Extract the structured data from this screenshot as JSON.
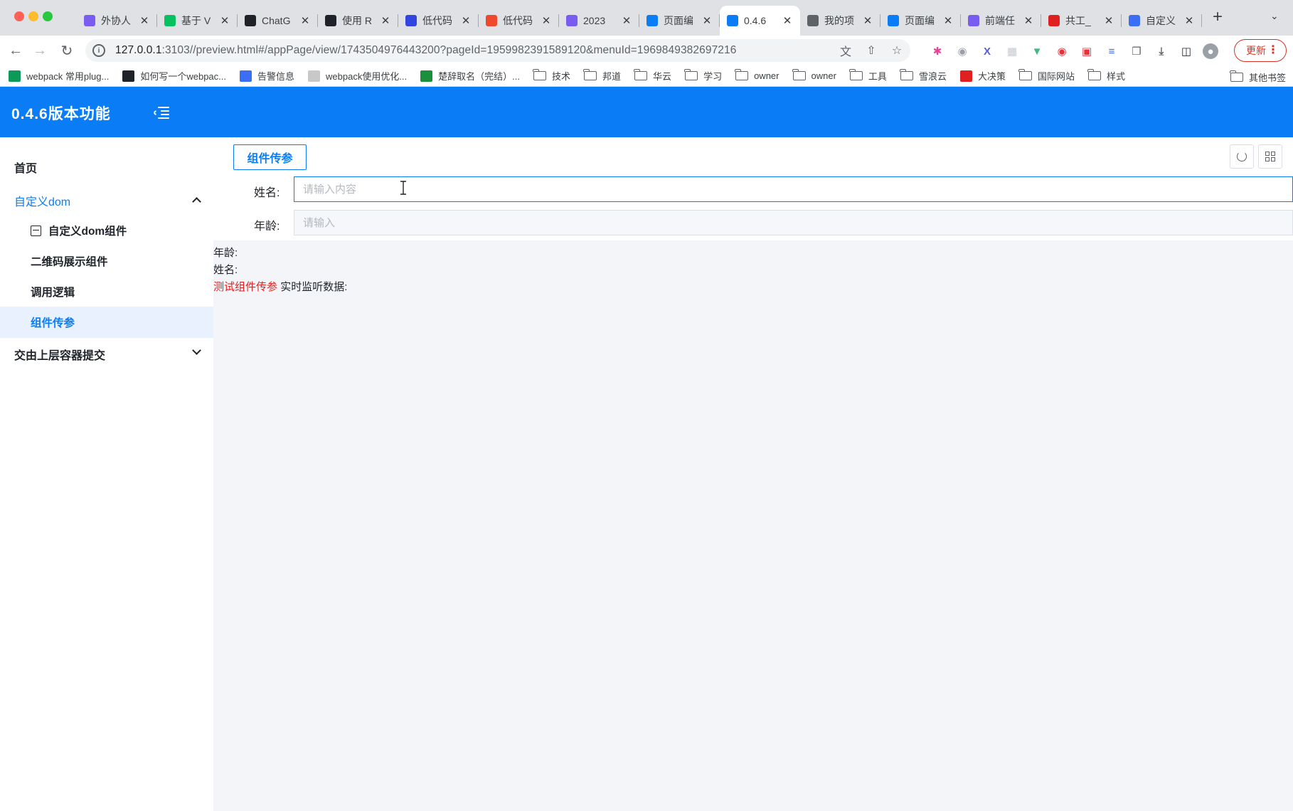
{
  "browser": {
    "tabs": [
      {
        "title": "外协人",
        "favicon_color": "#7b5cf0",
        "favicon": "list-icon"
      },
      {
        "title": "基于 V",
        "favicon_color": "#07c160",
        "favicon": "wechat-icon"
      },
      {
        "title": "ChatG",
        "favicon_color": "#1f2329",
        "favicon": "openai-icon"
      },
      {
        "title": "使用 R",
        "favicon_color": "#1f2329",
        "favicon": "cursor-icon"
      },
      {
        "title": "低代码",
        "favicon_color": "#3245df",
        "favicon": "baidu-icon"
      },
      {
        "title": "低代码",
        "favicon_color": "#f0482e",
        "favicon": "csdn-icon"
      },
      {
        "title": "2023",
        "favicon_color": "#7b5cf0",
        "favicon": "list-icon"
      },
      {
        "title": "页面编",
        "favicon_color": "#0a7cf6",
        "favicon": "app-icon"
      },
      {
        "title": "0.4.6",
        "favicon_color": "#0a7cf6",
        "favicon": "app-icon",
        "active": true
      },
      {
        "title": "我的项",
        "favicon_color": "#5f6368",
        "favicon": "globe-icon"
      },
      {
        "title": "页面编",
        "favicon_color": "#0a7cf6",
        "favicon": "app-icon"
      },
      {
        "title": "前端任",
        "favicon_color": "#7b5cf0",
        "favicon": "list-icon"
      },
      {
        "title": "共工_",
        "favicon_color": "#e02020",
        "favicon": "badge-icon"
      },
      {
        "title": "自定义",
        "favicon_color": "#3b6ef5",
        "favicon": "doc-icon"
      }
    ],
    "url_host": "127.0.0.1",
    "url_rest": ":3103//preview.html#/appPage/view/1743504976443200?pageId=1959982391589120&menuId=1969849382697216",
    "update_label": "更新",
    "bookmarks": [
      {
        "label": "webpack 常用plug...",
        "icon": "sf-icon",
        "color": "#0d9a58"
      },
      {
        "label": "如何写一个webpac...",
        "icon": "github-icon",
        "color": "#1f2329"
      },
      {
        "label": "告警信息",
        "icon": "bird-icon",
        "color": "#3b6ef5"
      },
      {
        "label": "webpack使用优化...",
        "icon": "egg-icon",
        "color": "#c8c8c8"
      },
      {
        "label": "楚辞取名（完结）...",
        "icon": "chuci-icon",
        "color": "#1a8f3c"
      },
      {
        "label": "技术",
        "icon": "folder-icon"
      },
      {
        "label": "邦道",
        "icon": "folder-icon"
      },
      {
        "label": "华云",
        "icon": "folder-icon"
      },
      {
        "label": "学习",
        "icon": "folder-icon"
      },
      {
        "label": "owner",
        "icon": "folder-icon"
      },
      {
        "label": "owner",
        "icon": "folder-icon"
      },
      {
        "label": "工具",
        "icon": "folder-icon"
      },
      {
        "label": "雪浪云",
        "icon": "folder-icon"
      },
      {
        "label": "大决策",
        "icon": "decision-icon",
        "color": "#e02020"
      },
      {
        "label": "国际网站",
        "icon": "folder-icon"
      },
      {
        "label": "样式",
        "icon": "folder-icon"
      }
    ],
    "other_bookmarks": "其他书签"
  },
  "app": {
    "title": "0.4.6版本功能",
    "accent": "#0a7cf6",
    "menu": {
      "home": "首页",
      "group1": "自定义dom",
      "group1_items": [
        "自定义dom组件",
        "二维码展示组件",
        "调用逻辑",
        "组件传参"
      ],
      "group2": "交由上层容器提交"
    },
    "active_tab": "组件传参",
    "form": {
      "name_label": "姓名:",
      "name_placeholder": "请输入内容",
      "age_label": "年龄:",
      "age_placeholder": "请输入"
    },
    "output": {
      "age_line": "年龄:",
      "name_line": "姓名:",
      "test_label": "测试组件传参",
      "listen_label": "实时监听数据:"
    }
  }
}
